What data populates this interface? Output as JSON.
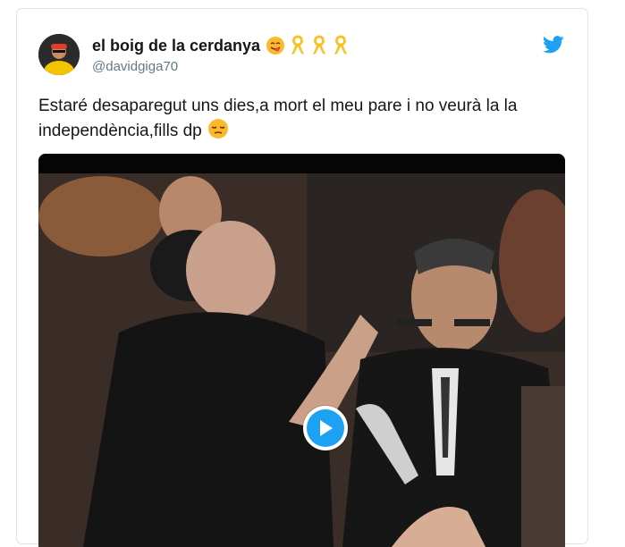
{
  "tweet": {
    "display_name": "el boig de la cerdanya",
    "handle": "@davidgiga70",
    "text": "Estaré desaparegut uns dies,a mort el meu pare i no veurà la la independència,fills dp",
    "name_emojis": [
      "yummy-face-emoji",
      "yellow-ribbon-icon",
      "yellow-ribbon-icon",
      "yellow-ribbon-icon"
    ],
    "text_emoji": "pensive-face-emoji"
  },
  "colors": {
    "brand_blue": "#1da1f2",
    "text": "#14171a",
    "secondary": "#657786",
    "border": "#dfe3e6",
    "ribbon": "#f7c328"
  },
  "media": {
    "type": "video",
    "play_icon": "play-icon"
  }
}
